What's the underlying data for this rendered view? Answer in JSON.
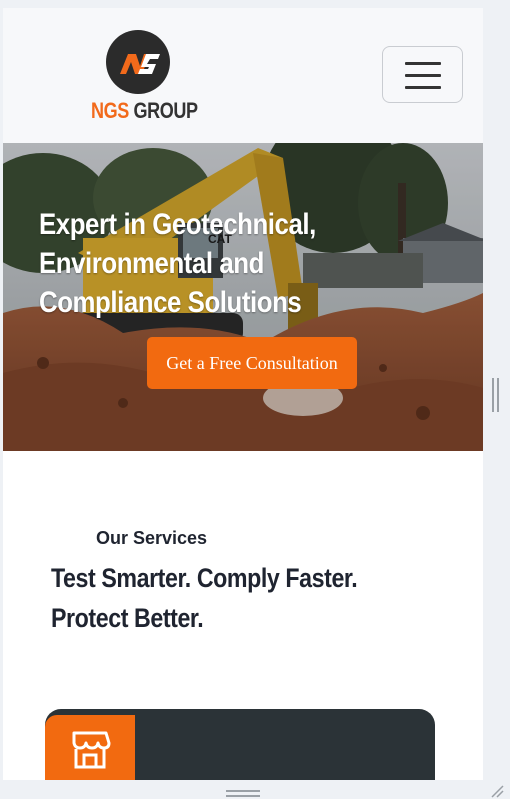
{
  "header": {
    "logo_text_ngs": "NGS",
    "logo_text_group": "GROUP",
    "menu_icon": "hamburger-menu-icon"
  },
  "hero": {
    "title": "Expert in Geotechnical, Environmental and Compliance Solutions",
    "cta_label": "Get a Free Consultation"
  },
  "services": {
    "label": "Our Services",
    "heading": "Test Smarter. Comply Faster. Protect Better.",
    "card_icon": "storefront-icon"
  },
  "colors": {
    "accent": "#f26a10",
    "dark": "#2b3337",
    "text": "#1f2430"
  }
}
